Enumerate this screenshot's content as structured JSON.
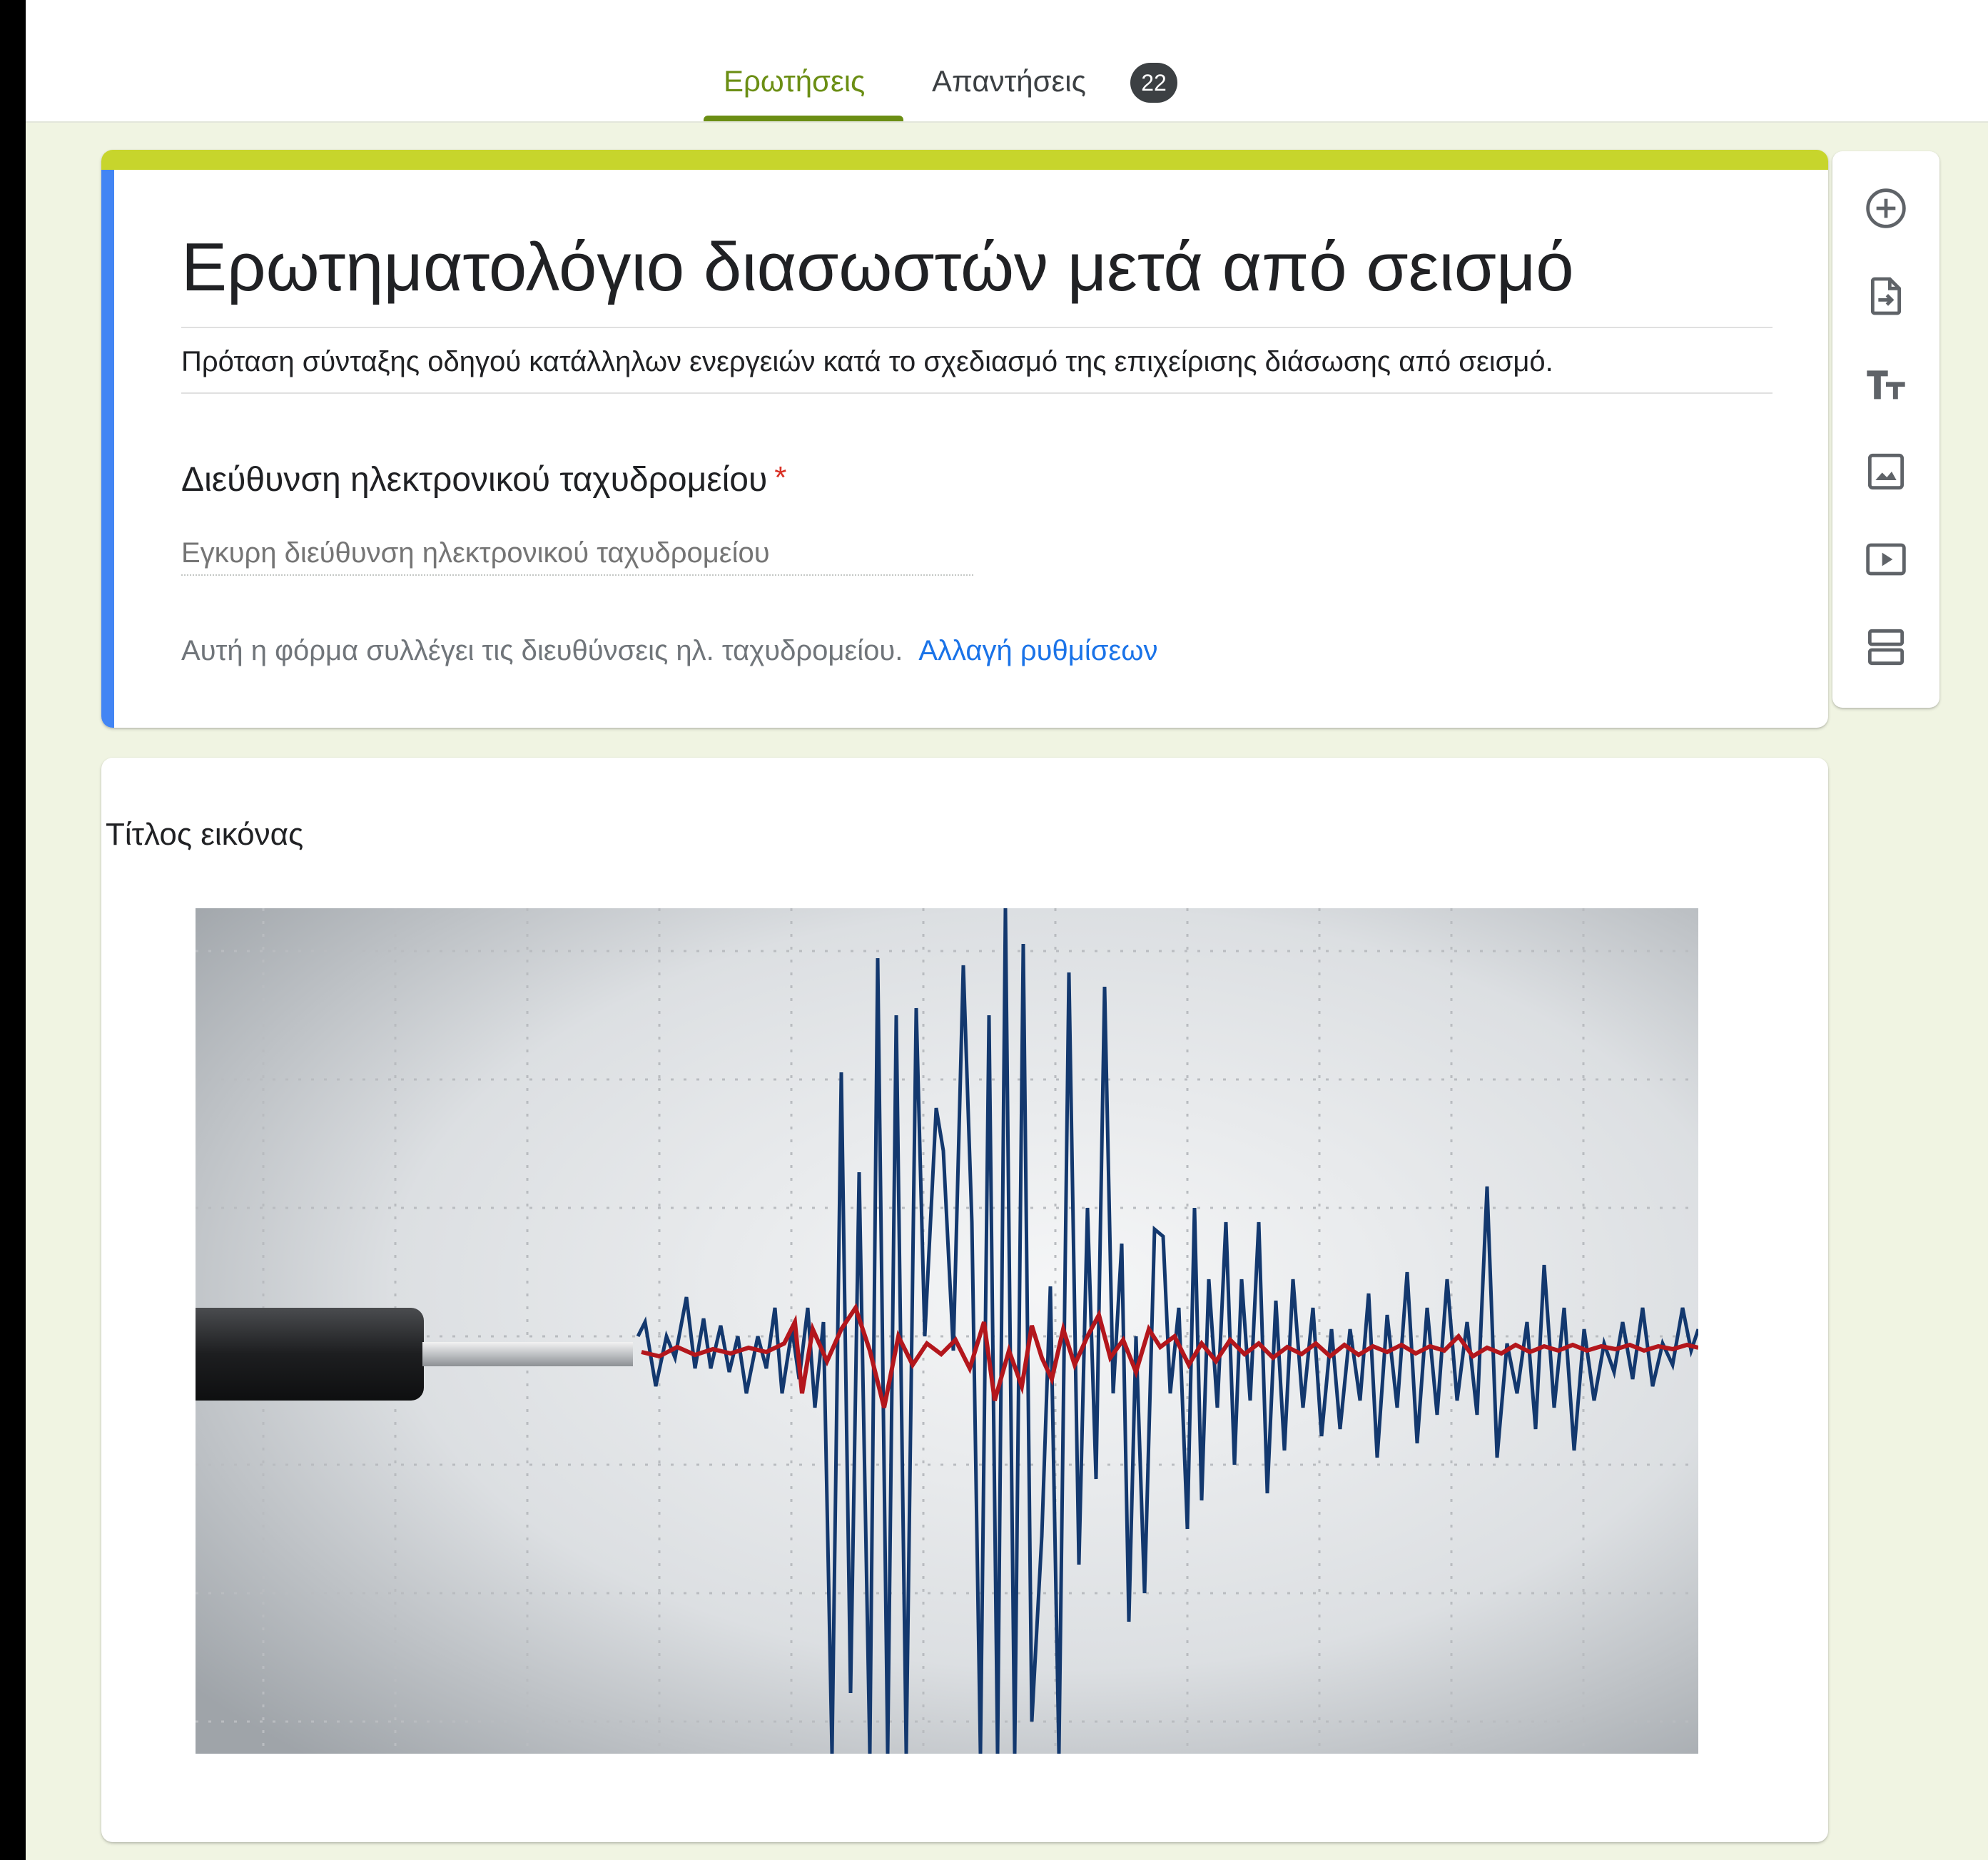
{
  "tabs": {
    "questions": "Ερωτήσεις",
    "responses": "Απαντήσεις",
    "responses_count": "22"
  },
  "form": {
    "title": "Ερωτηματολόγιο διασωστών μετά από σεισμό",
    "description": "Πρόταση σύνταξης οδηγού κατάλληλων ενεργειών κατά το σχεδιασμό της επιχείρισης διάσωσης από σεισμό.",
    "email_question": "Διεύθυνση ηλεκτρονικού ταχυδρομείου",
    "required_mark": "*",
    "email_placeholder": "Εγκυρη διεύθυνση ηλεκτρονικού ταχυδρομείου",
    "collect_note": "Αυτή η φόρμα συλλέγει τις διευθύνσεις ηλ. ταχυδρομείου.",
    "settings_link": "Αλλαγή ρυθμίσεων"
  },
  "image_item": {
    "title": "Τίτλος εικόνας",
    "image_subject": "seismograph"
  },
  "toolbar": {
    "icons": [
      "add-circle-icon",
      "import-questions-icon",
      "title-text-icon",
      "image-icon",
      "video-icon",
      "section-icon"
    ]
  },
  "colors": {
    "accent": "#c7d52c",
    "tab_active": "#6b8e14",
    "left_bar": "#4285f4",
    "page_bg": "#f0f4e2",
    "link": "#1a73e8",
    "required": "#d93025"
  }
}
